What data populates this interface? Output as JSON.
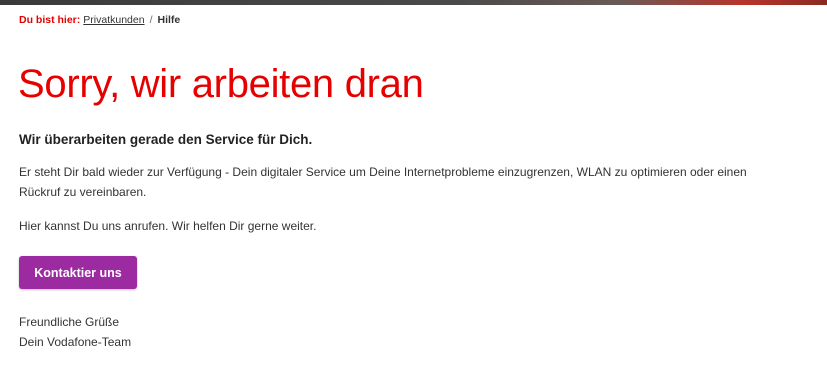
{
  "colors": {
    "accent_red": "#e60000",
    "button_purple": "#9c2aa0",
    "text": "#333333"
  },
  "breadcrumb": {
    "lead": "Du bist hier:",
    "items": [
      {
        "label": "Privatkunden"
      },
      {
        "label": "Hilfe"
      }
    ],
    "separator": "/"
  },
  "main": {
    "title": "Sorry, wir arbeiten dran",
    "subtitle": "Wir überarbeiten gerade den Service für Dich.",
    "paragraph_1": "Er steht Dir bald wieder zur Verfügung - Dein digitaler Service um Deine Internetprobleme einzugrenzen, WLAN zu optimieren oder einen Rückruf zu vereinbaren.",
    "paragraph_2": "Hier kannst Du uns anrufen. Wir helfen Dir gerne weiter.",
    "contact_button": "Kontaktier uns",
    "closing_line_1": "Freundliche Grüße",
    "closing_line_2": "Dein Vodafone-Team"
  }
}
